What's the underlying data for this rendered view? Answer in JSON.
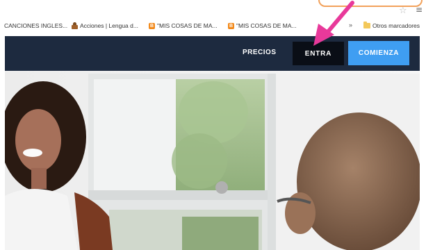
{
  "bookmarks": [
    {
      "label": "CANCIONES INGLES...",
      "icon": "none"
    },
    {
      "label": "Acciones | Lengua d...",
      "icon": "acorn-icon"
    },
    {
      "label": "\"MIS COSAS DE MA...",
      "icon": "blogger-icon"
    },
    {
      "label": "\"MIS COSAS DE MA...",
      "icon": "blogger-icon"
    }
  ],
  "bookmarks_more": "»",
  "other_bookmarks": "Otros marcadores",
  "nav": {
    "precios": "PRECIOS",
    "entra": "ENTRA",
    "comienza": "COMIENZA"
  },
  "colors": {
    "navbar": "#1d2a3f",
    "entra_bg": "#0a0e16",
    "comienza_bg": "#3f9ef2",
    "annotation_arrow": "#e8399a",
    "annotation_box": "#f2a15a"
  }
}
